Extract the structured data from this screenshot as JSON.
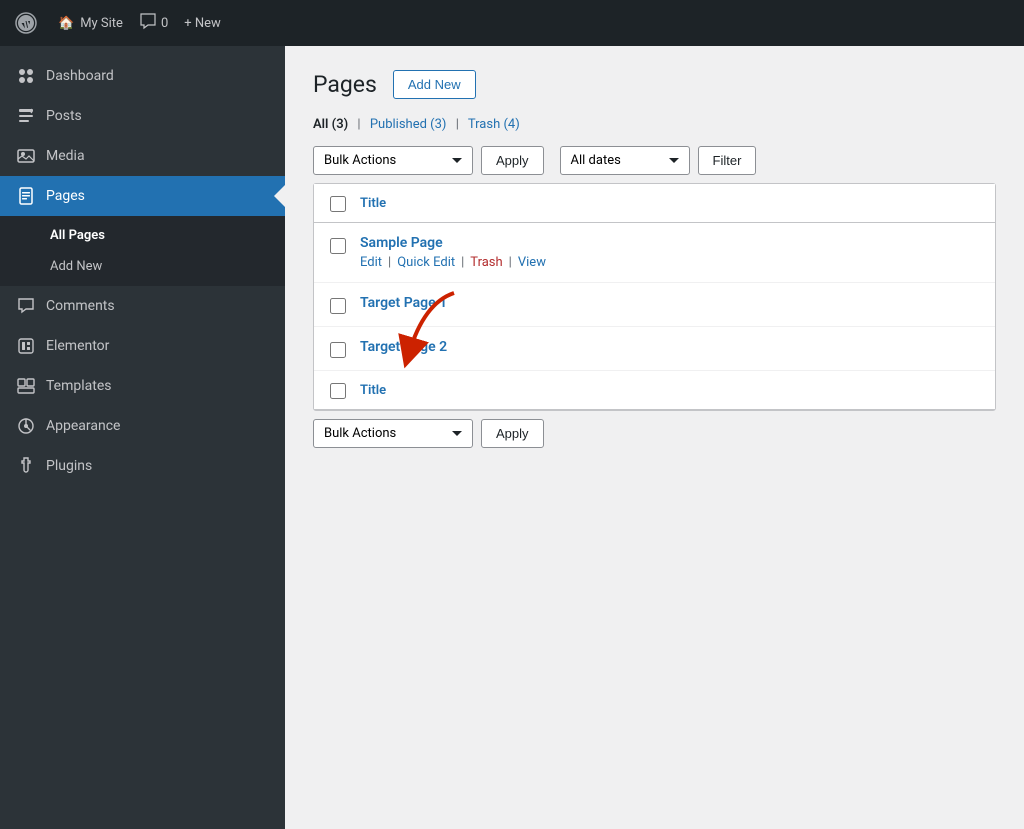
{
  "topbar": {
    "wp_logo": "⊕",
    "site_icon": "🏠",
    "site_name": "My Site",
    "comments_icon": "💬",
    "comments_count": "0",
    "new_label": "+ New"
  },
  "sidebar": {
    "items": [
      {
        "id": "dashboard",
        "label": "Dashboard",
        "icon": "🎨"
      },
      {
        "id": "posts",
        "label": "Posts",
        "icon": "📌"
      },
      {
        "id": "media",
        "label": "Media",
        "icon": "🖼"
      },
      {
        "id": "pages",
        "label": "Pages",
        "icon": "📄",
        "active": true
      }
    ],
    "pages_submenu": [
      {
        "id": "all-pages",
        "label": "All Pages",
        "active": true
      },
      {
        "id": "add-new",
        "label": "Add New"
      }
    ],
    "items_below": [
      {
        "id": "comments",
        "label": "Comments",
        "icon": "💬"
      },
      {
        "id": "elementor",
        "label": "Elementor",
        "icon": "📋"
      },
      {
        "id": "templates",
        "label": "Templates",
        "icon": "📁"
      },
      {
        "id": "appearance",
        "label": "Appearance",
        "icon": "🖌"
      },
      {
        "id": "plugins",
        "label": "Plugins",
        "icon": "🔧"
      }
    ]
  },
  "main": {
    "page_title": "Pages",
    "add_new_label": "Add New",
    "filter_links": {
      "all_label": "All",
      "all_count": "(3)",
      "published_label": "Published",
      "published_count": "(3)",
      "trash_label": "Trash",
      "trash_count": "(4)"
    },
    "bulk_actions_label": "Bulk Actions",
    "apply_label": "Apply",
    "all_dates_label": "All dates",
    "filter_label": "Filter",
    "title_header": "Title",
    "rows": [
      {
        "id": "sample-page",
        "title": "Sample Page",
        "actions": [
          "Edit",
          "Quick Edit",
          "Trash",
          "View"
        ]
      },
      {
        "id": "target-page-1",
        "title": "Target Page 1",
        "actions": []
      },
      {
        "id": "target-page-2",
        "title": "Target Page 2",
        "actions": []
      }
    ],
    "title_footer": "Title",
    "bulk_actions_bottom": "Bulk Actions",
    "apply_bottom": "Apply"
  }
}
